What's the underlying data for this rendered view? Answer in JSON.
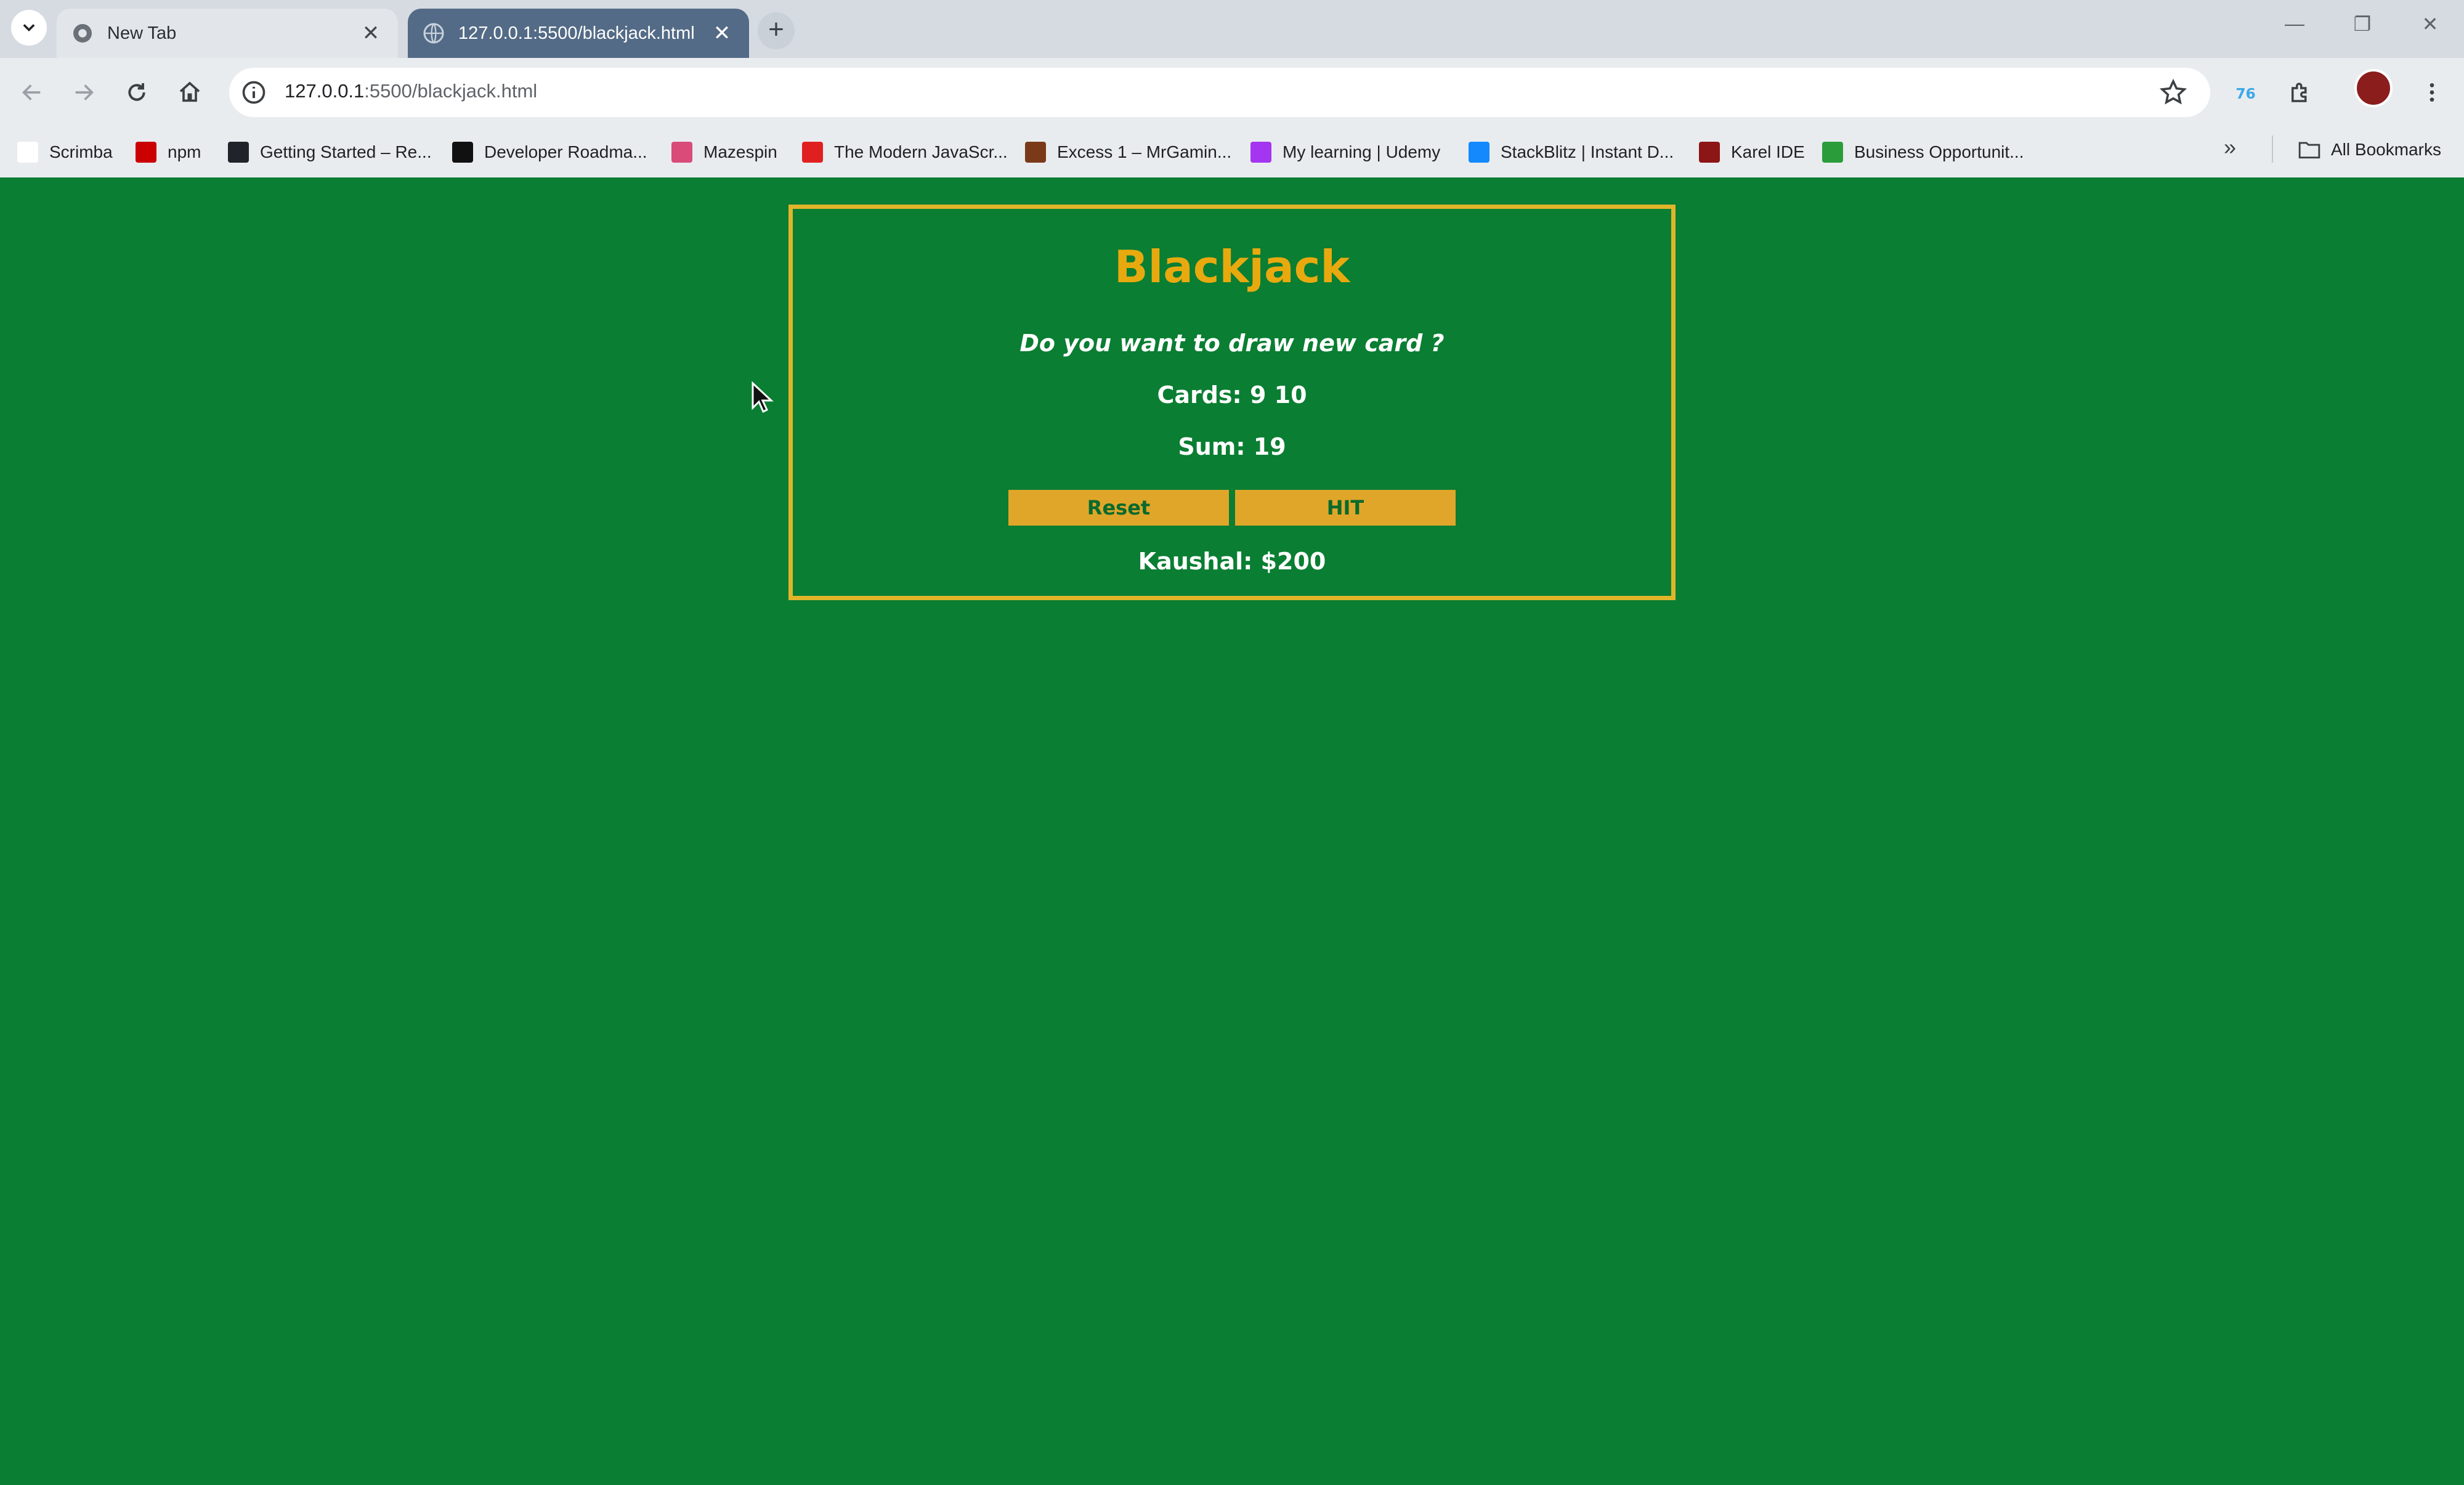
{
  "browser": {
    "tabs": [
      {
        "title": "New Tab",
        "active": false
      },
      {
        "title": "127.0.0.1:5500/blackjack.html",
        "active": true
      }
    ],
    "address": {
      "host": "127.0.0.1",
      "path": ":5500/blackjack.html"
    },
    "bookmarks": [
      {
        "label": "Scrimba",
        "icon": "scrimba-icon",
        "color": "#ffffff"
      },
      {
        "label": "npm",
        "icon": "npm-icon",
        "color": "#cb0000"
      },
      {
        "label": "Getting Started – Re...",
        "icon": "react-icon",
        "color": "#20232a"
      },
      {
        "label": "Developer Roadma...",
        "icon": "roadmap-icon",
        "color": "#111111"
      },
      {
        "label": "Mazespin",
        "icon": "mazespin-icon",
        "color": "#d94c7a"
      },
      {
        "label": "The Modern JavaScr...",
        "icon": "javascript-icon",
        "color": "#e02020"
      },
      {
        "label": "Excess 1 – MrGamin...",
        "icon": "mrgaming-icon",
        "color": "#7a3a1a"
      },
      {
        "label": "My learning | Udemy",
        "icon": "udemy-icon",
        "color": "#a435f0"
      },
      {
        "label": "StackBlitz | Instant D...",
        "icon": "stackblitz-icon",
        "color": "#1389fd"
      },
      {
        "label": "Karel IDE",
        "icon": "karel-icon",
        "color": "#8c1515"
      },
      {
        "label": "Business Opportunit...",
        "icon": "business-icon",
        "color": "#2a9d3a"
      }
    ],
    "all_bookmarks_label": "All Bookmarks"
  },
  "game": {
    "title": "Blackjack",
    "message": "Do you want to draw new card ?",
    "cards_text": "Cards: 9 10",
    "sum_text": "Sum: 19",
    "reset_label": "Reset",
    "hit_label": "HIT",
    "player_text": "Kaushal: $200"
  },
  "colors": {
    "page_bg": "#0a7e32",
    "accent": "#e0a62a",
    "title": "#e8a90f",
    "active_tab": "#536b86"
  }
}
